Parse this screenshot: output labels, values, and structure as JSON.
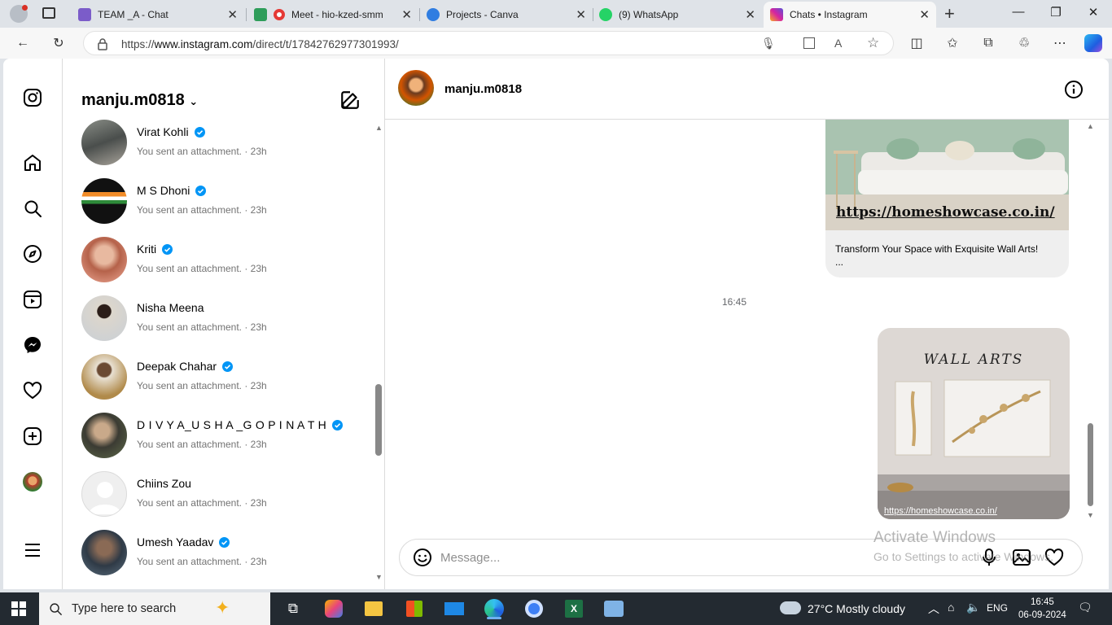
{
  "browser": {
    "tabs": [
      {
        "title": "TEAM _A - Chat",
        "color": "#7b5cc9"
      },
      {
        "title": "Meet - hio-kzed-smm",
        "color": "#e53935"
      },
      {
        "title": "Projects - Canva",
        "color": "#2f7de1"
      },
      {
        "title": "(9) WhatsApp",
        "color": "#25d366"
      },
      {
        "title": "Chats • Instagram",
        "color": "#d6249f"
      }
    ],
    "url_prefix": "https://",
    "url_domain": "www.instagram.com",
    "url_path": "/direct/t/17842762977301993/"
  },
  "inbox": {
    "username": "manju.m0818",
    "threads": [
      {
        "name": "Virat Kohli",
        "verified": true,
        "preview": "You sent an attachment. · 23h"
      },
      {
        "name": "M S Dhoni",
        "verified": true,
        "preview": "You sent an attachment. · 23h"
      },
      {
        "name": "Kriti",
        "verified": true,
        "preview": "You sent an attachment. · 23h"
      },
      {
        "name": "Nisha Meena",
        "verified": false,
        "preview": "You sent an attachment. · 23h"
      },
      {
        "name": "Deepak Chahar",
        "verified": true,
        "preview": "You sent an attachment. · 23h"
      },
      {
        "name": "D I V Y A_U S H A _G O P I N A T H",
        "verified": true,
        "preview": "You sent an attachment. · 23h"
      },
      {
        "name": "Chiins Zou",
        "verified": false,
        "preview": "You sent an attachment. · 23h"
      },
      {
        "name": "Umesh Yaadav",
        "verified": true,
        "preview": "You sent an attachment. · 23h"
      }
    ]
  },
  "chat": {
    "contact_name": "manju.m0818",
    "link_card": {
      "url": "https://homeshowcase.co.in/",
      "title": "Transform Your Space with Exquisite Wall Arts!",
      "ellipsis": "..."
    },
    "timestamp": "16:45",
    "image_message": {
      "heading": "WALL ARTS",
      "url": "https://homeshowcase.co.in/"
    },
    "composer_placeholder": "Message..."
  },
  "watermark": {
    "line1": "Activate Windows",
    "line2": "Go to Settings to activate Windows."
  },
  "taskbar": {
    "search_placeholder": "Type here to search",
    "weather": "27°C  Mostly cloudy",
    "language": "ENG",
    "time": "16:45",
    "date": "06-09-2024"
  }
}
